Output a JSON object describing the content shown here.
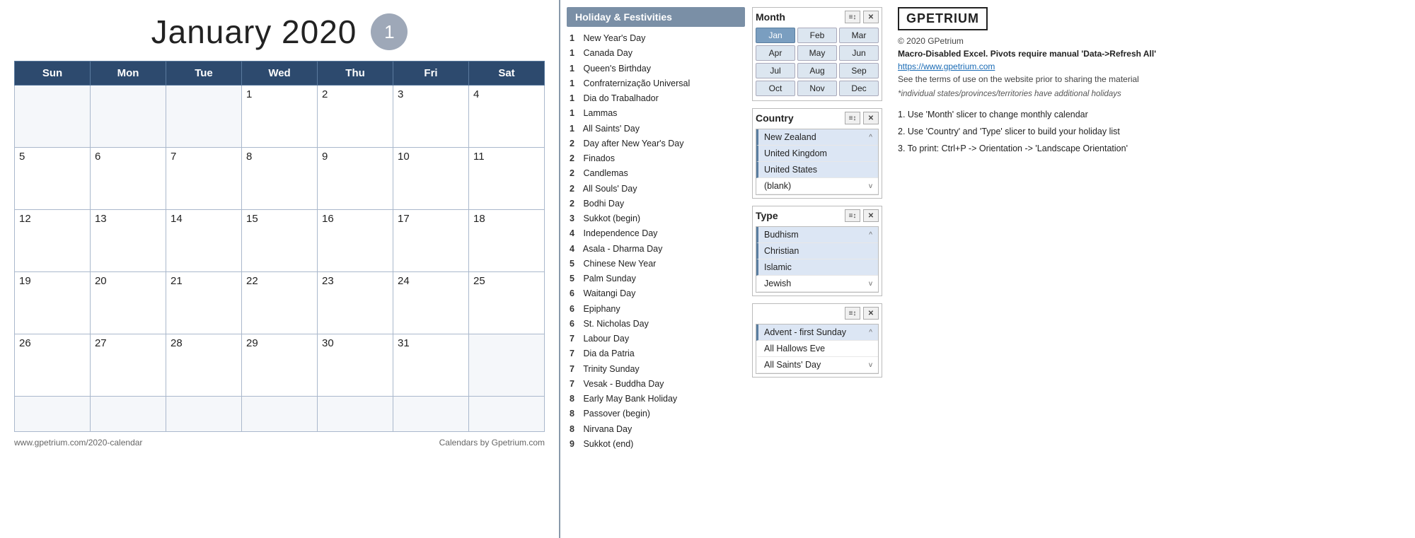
{
  "calendar": {
    "title": "January 2020",
    "badge": "1",
    "days_of_week": [
      "Sun",
      "Mon",
      "Tue",
      "Wed",
      "Thu",
      "Fri",
      "Sat"
    ],
    "weeks": [
      [
        "",
        "",
        "",
        "1",
        "2",
        "3",
        "4"
      ],
      [
        "5",
        "6",
        "7",
        "8",
        "9",
        "10",
        "11"
      ],
      [
        "12",
        "13",
        "14",
        "15",
        "16",
        "17",
        "18"
      ],
      [
        "19",
        "20",
        "21",
        "22",
        "23",
        "24",
        "25"
      ],
      [
        "26",
        "27",
        "28",
        "29",
        "30",
        "31",
        ""
      ],
      [
        "",
        "",
        "",
        "",
        "",
        "",
        ""
      ]
    ],
    "footer_left": "www.gpetrium.com/2020-calendar",
    "footer_right": "Calendars by Gpetrium.com"
  },
  "holiday_panel": {
    "title": "Holiday & Festivities",
    "items": [
      {
        "day": "1",
        "name": "New Year's Day"
      },
      {
        "day": "1",
        "name": "Canada Day"
      },
      {
        "day": "1",
        "name": "Queen's Birthday"
      },
      {
        "day": "1",
        "name": "Confraternização Universal"
      },
      {
        "day": "1",
        "name": "Dia do Trabalhador"
      },
      {
        "day": "1",
        "name": "Lammas"
      },
      {
        "day": "1",
        "name": "All Saints' Day"
      },
      {
        "day": "2",
        "name": "Day after New Year's Day"
      },
      {
        "day": "2",
        "name": "Finados"
      },
      {
        "day": "2",
        "name": "Candlemas"
      },
      {
        "day": "2",
        "name": "All Souls' Day"
      },
      {
        "day": "2",
        "name": "Bodhi Day"
      },
      {
        "day": "3",
        "name": "Sukkot (begin)"
      },
      {
        "day": "4",
        "name": "Independence Day"
      },
      {
        "day": "4",
        "name": "Asala - Dharma Day"
      },
      {
        "day": "5",
        "name": "Chinese New Year"
      },
      {
        "day": "5",
        "name": "Palm Sunday"
      },
      {
        "day": "6",
        "name": "Waitangi Day"
      },
      {
        "day": "6",
        "name": "Epiphany"
      },
      {
        "day": "6",
        "name": "St. Nicholas Day"
      },
      {
        "day": "7",
        "name": "Labour Day"
      },
      {
        "day": "7",
        "name": "Dia da Patria"
      },
      {
        "day": "7",
        "name": "Trinity Sunday"
      },
      {
        "day": "7",
        "name": "Vesak - Buddha Day"
      },
      {
        "day": "8",
        "name": "Early May Bank Holiday"
      },
      {
        "day": "8",
        "name": "Passover (begin)"
      },
      {
        "day": "8",
        "name": "Nirvana Day"
      },
      {
        "day": "9",
        "name": "Sukkot (end)"
      }
    ]
  },
  "month_slicer": {
    "label": "Month",
    "months": [
      "Jan",
      "Feb",
      "Mar",
      "Apr",
      "May",
      "Jun",
      "Jul",
      "Aug",
      "Sep",
      "Oct",
      "Nov",
      "Dec"
    ],
    "active": "Jan"
  },
  "country_slicer": {
    "label": "Country",
    "items": [
      "New Zealand",
      "United Kingdom",
      "United States",
      "(blank)"
    ],
    "selected": [
      "New Zealand",
      "United Kingdom",
      "United States"
    ]
  },
  "type_slicer": {
    "label": "Type",
    "items": [
      "Budhism",
      "Christian",
      "Islamic",
      "Jewish"
    ],
    "selected": [
      "Budhism",
      "Christian",
      "Islamic"
    ]
  },
  "holiday_name_slicer": {
    "label": "",
    "items": [
      "Advent - first Sunday",
      "All Hallows Eve",
      "All Saints' Day"
    ],
    "selected": [
      "Advent - first Sunday"
    ]
  },
  "info": {
    "logo": "GPETRIUM",
    "copyright": "© 2020 GPetrium",
    "warning": "Macro-Disabled Excel. Pivots require manual 'Data->Refresh All'",
    "link": "https://www.gpetrium.com",
    "terms": "See the terms of use on the website prior to sharing the material",
    "note": "*individual states/provinces/territories have additional holidays",
    "instructions": [
      "1. Use 'Month' slicer to change monthly calendar",
      "2. Use 'Country' and 'Type' slicer to build your holiday list",
      "3. To print: Ctrl+P -> Orientation -> 'Landscape Orientation'"
    ]
  }
}
